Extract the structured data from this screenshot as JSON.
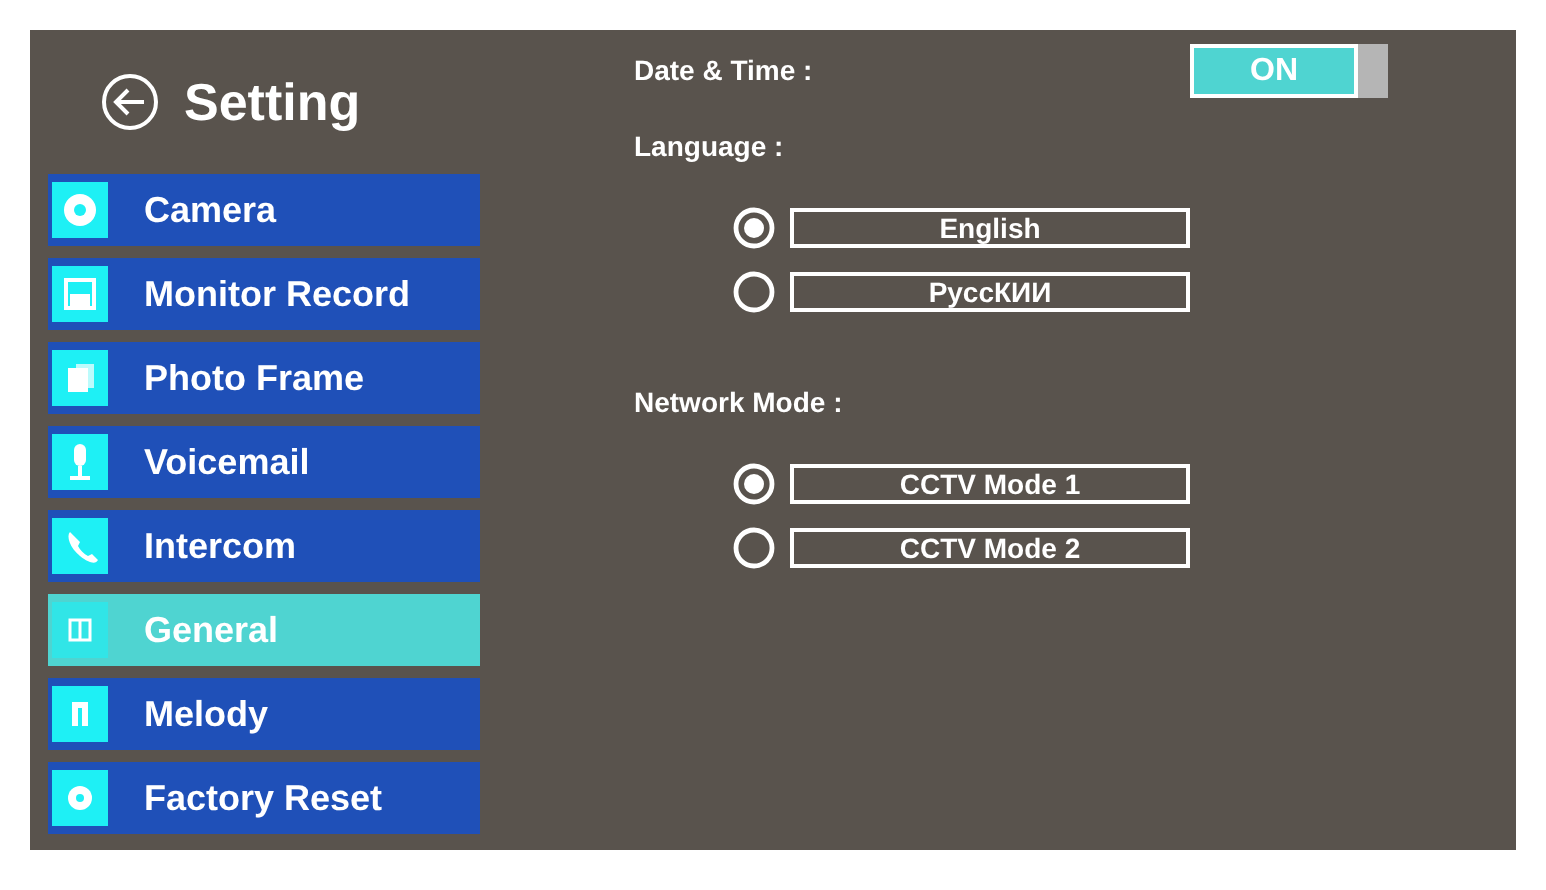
{
  "header": {
    "title": "Setting"
  },
  "sidebar": {
    "items": [
      {
        "label": "Camera",
        "selected": false
      },
      {
        "label": "Monitor Record",
        "selected": false
      },
      {
        "label": "Photo  Frame",
        "selected": false
      },
      {
        "label": "Voicemail",
        "selected": false
      },
      {
        "label": "Intercom",
        "selected": false
      },
      {
        "label": "General",
        "selected": true
      },
      {
        "label": "Melody",
        "selected": false
      },
      {
        "label": "Factory Reset",
        "selected": false
      }
    ]
  },
  "settings": [
    {
      "kind": "toggle",
      "label": "Date & Time :",
      "value": "ON",
      "on": true
    },
    {
      "kind": "radio",
      "label": "Language :",
      "options": [
        {
          "label": "English",
          "selected": true
        },
        {
          "label": "PycсКИИ",
          "selected": false
        }
      ]
    },
    {
      "kind": "radio",
      "label": "Network Mode :",
      "options": [
        {
          "label": "CCTV Mode 1",
          "selected": true
        },
        {
          "label": "CCTV Mode 2",
          "selected": false
        }
      ]
    }
  ]
}
